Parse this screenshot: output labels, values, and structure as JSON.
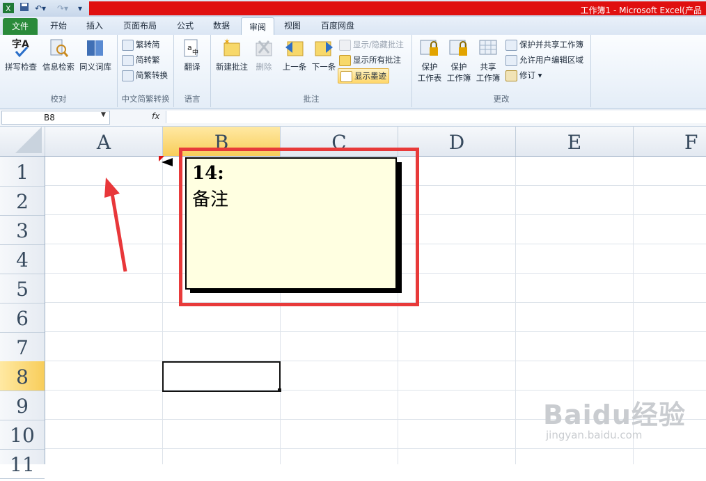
{
  "title_bar": {
    "title": "工作簿1 - Microsoft Excel(产品"
  },
  "quick_access": {
    "undo_icon": "undo-icon",
    "redo_icon": "redo-icon",
    "save_icon": "save-icon"
  },
  "tabs": [
    "文件",
    "开始",
    "插入",
    "页面布局",
    "公式",
    "数据",
    "审阅",
    "视图",
    "百度网盘"
  ],
  "active_tab": "审阅",
  "ribbon": {
    "proofing": {
      "label": "校对",
      "buttons": [
        "拼写检查",
        "信息检索",
        "同义词库"
      ]
    },
    "chinese_conversion": {
      "label": "中文简繁转换",
      "buttons": [
        "繁转简",
        "简转繁",
        "简繁转换"
      ]
    },
    "language": {
      "label": "语言",
      "buttons": [
        "翻译"
      ]
    },
    "comments": {
      "label": "批注",
      "buttons": [
        "新建批注",
        "删除",
        "上一条",
        "下一条"
      ],
      "small": [
        "显示/隐藏批注",
        "显示所有批注",
        "显示墨迹"
      ]
    },
    "changes": {
      "label": "更改",
      "big": [
        {
          "line1": "保护",
          "line2": "工作表"
        },
        {
          "line1": "保护",
          "line2": "工作簿"
        },
        {
          "line1": "共享",
          "line2": "工作簿"
        }
      ],
      "small": [
        "保护并共享工作簿",
        "允许用户编辑区域",
        "修订"
      ]
    }
  },
  "formula_bar": {
    "name_box": "B8",
    "fx_label": "fx",
    "value": ""
  },
  "grid": {
    "columns": [
      "A",
      "B",
      "C",
      "D",
      "E",
      "F"
    ],
    "rows": [
      "1",
      "2",
      "3",
      "4",
      "5",
      "6",
      "7",
      "8",
      "9",
      "10",
      "11"
    ],
    "selected_cell": "B8"
  },
  "comment": {
    "author": "14:",
    "text": "备注"
  },
  "watermark": {
    "main": "Baidu经验",
    "sub": "jingyan.baidu.com"
  },
  "colors": {
    "file_tab": "#2a8a3a",
    "highlight_box": "#e83a3a",
    "comment_bg": "#ffffe1",
    "selected_header": "#f8cd5a"
  }
}
